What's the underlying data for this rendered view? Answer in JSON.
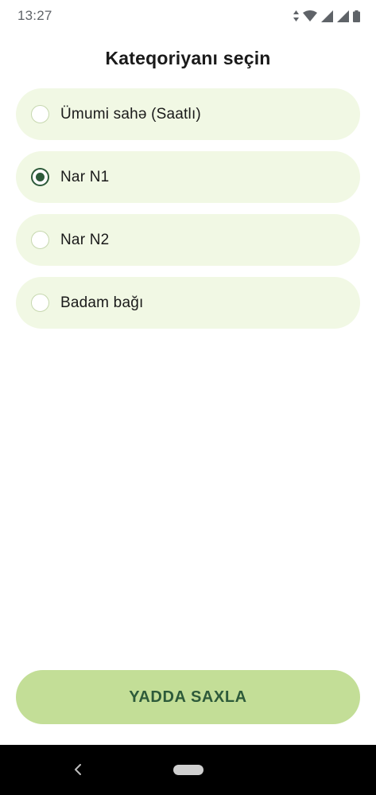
{
  "status_bar": {
    "time": "13:27",
    "icons": [
      "data-arrows-icon",
      "wifi-icon",
      "signal-icon",
      "signal-icon-2",
      "battery-icon"
    ]
  },
  "page": {
    "title": "Kateqoriyanı seçin"
  },
  "options": [
    {
      "label": "Ümumi sahə (Saatlı)",
      "selected": false
    },
    {
      "label": "Nar N1",
      "selected": true
    },
    {
      "label": "Nar N2",
      "selected": false
    },
    {
      "label": "Badam bağı",
      "selected": false
    }
  ],
  "save_button": {
    "label": "YADDA SAXLA"
  },
  "colors": {
    "option_bg": "#f1f8e4",
    "radio_selected": "#2d5a3a",
    "button_bg": "#c3de97",
    "button_text": "#2d5a3a"
  }
}
